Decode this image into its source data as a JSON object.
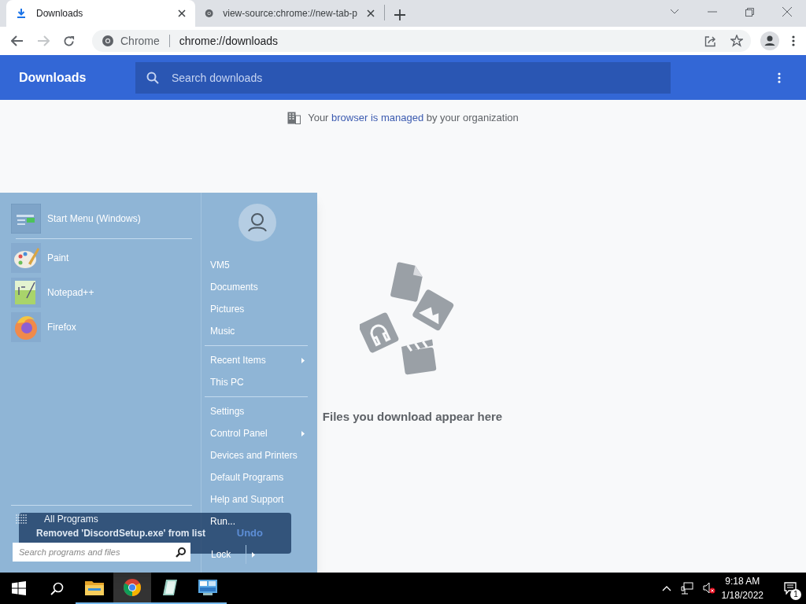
{
  "browser": {
    "tabs": [
      {
        "title": "Downloads",
        "kind": "download",
        "selected": true
      },
      {
        "title": "view-source:chrome://new-tab-p",
        "kind": "chrome",
        "selected": false
      }
    ],
    "omnibox": {
      "chip": "Chrome",
      "url": "chrome://downloads"
    }
  },
  "downloads_page": {
    "title": "Downloads",
    "search_placeholder": "Search downloads",
    "managed_notice": {
      "before": "Your",
      "link": "browser is managed",
      "after": "by your organization"
    },
    "empty_message": "Files you download appear here"
  },
  "start_menu": {
    "pinned": [
      {
        "label": "Start Menu (Windows)",
        "kind": "start"
      },
      {
        "label": "Paint",
        "kind": "paint"
      },
      {
        "label": "Notepad++",
        "kind": "notepad"
      },
      {
        "label": "Firefox",
        "kind": "firefox"
      }
    ],
    "all_programs": "All Programs",
    "search_placeholder": "Search programs and files",
    "places": [
      [
        {
          "label": "VM5",
          "submenu": false
        },
        {
          "label": "Documents",
          "submenu": false
        },
        {
          "label": "Pictures",
          "submenu": false
        },
        {
          "label": "Music",
          "submenu": false
        }
      ],
      [
        {
          "label": "Recent Items",
          "submenu": true
        },
        {
          "label": "This PC",
          "submenu": false
        }
      ],
      [
        {
          "label": "Settings",
          "submenu": false
        },
        {
          "label": "Control Panel",
          "submenu": true
        },
        {
          "label": "Devices and Printers",
          "submenu": false
        },
        {
          "label": "Default Programs",
          "submenu": false
        },
        {
          "label": "Help and Support",
          "submenu": false
        },
        {
          "label": "Run...",
          "submenu": false
        }
      ]
    ],
    "lock": "Lock"
  },
  "toast": {
    "message": "Removed 'DiscordSetup.exe' from list",
    "action": "Undo"
  },
  "taskbar": {
    "apps": [
      {
        "kind": "explorer",
        "selected": false
      },
      {
        "kind": "chrome",
        "selected": true
      },
      {
        "kind": "notepad",
        "selected": false
      },
      {
        "kind": "control",
        "selected": false
      }
    ],
    "time": "9:18 AM",
    "date": "1/18/2022",
    "notification_count": "1"
  }
}
